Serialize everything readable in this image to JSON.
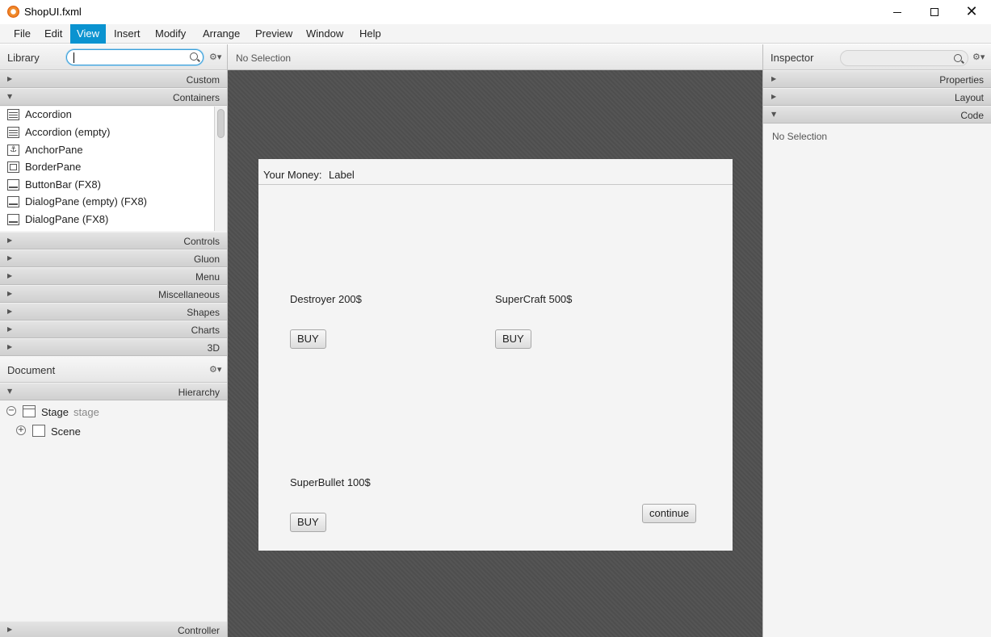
{
  "window": {
    "title": "ShopUI.fxml",
    "minimize_glyph": "",
    "maximize_glyph": "",
    "close_glyph": "✕"
  },
  "menu": [
    "File",
    "Edit",
    "View",
    "Insert",
    "Modify",
    "Arrange",
    "Preview",
    "Window",
    "Help"
  ],
  "menu_active": "View",
  "library": {
    "title": "Library",
    "search_value": "",
    "sections_top": [
      {
        "label": "Custom",
        "expanded": false
      },
      {
        "label": "Containers",
        "expanded": true
      }
    ],
    "items": [
      {
        "label": "Accordion",
        "icon": "accordion-icon"
      },
      {
        "label": "Accordion  (empty)",
        "icon": "accordion-icon"
      },
      {
        "label": "AnchorPane",
        "icon": "anchorpane-icon"
      },
      {
        "label": "BorderPane",
        "icon": "borderpane-icon"
      },
      {
        "label": "ButtonBar  (FX8)",
        "icon": "buttonbar-icon"
      },
      {
        "label": "DialogPane (empty)  (FX8)",
        "icon": "dialogpane-icon"
      },
      {
        "label": "DialogPane  (FX8)",
        "icon": "dialogpane-icon"
      }
    ],
    "sections_bottom": [
      "Controls",
      "Gluon",
      "Menu",
      "Miscellaneous",
      "Shapes",
      "Charts",
      "3D"
    ]
  },
  "document": {
    "title": "Document",
    "section": "Hierarchy",
    "tree": [
      {
        "label": "Stage",
        "sub": "stage",
        "expander": "−"
      },
      {
        "label": "Scene",
        "sub": "",
        "expander": "+"
      }
    ],
    "controller_label": "Controller"
  },
  "canvas": {
    "header": "No Selection",
    "money_label": "Your Money:",
    "money_value": "Label",
    "items": [
      {
        "label": "Destroyer  200$",
        "button": "BUY"
      },
      {
        "label": "SuperCraft  500$",
        "button": "BUY"
      },
      {
        "label": "SuperBullet  100$",
        "button": "BUY"
      }
    ],
    "continue_label": "continue"
  },
  "inspector": {
    "title": "Inspector",
    "search_value": "",
    "sections": [
      {
        "label": "Properties",
        "expanded": false
      },
      {
        "label": "Layout",
        "expanded": false
      },
      {
        "label": "Code",
        "expanded": true
      }
    ],
    "empty_text": "No Selection"
  },
  "colors": {
    "menu_active_bg": "#0a93d0",
    "canvas_bg": "#4e4e4e",
    "scene_bg": "#f4f4f4",
    "app_icon": "#f08a2a"
  }
}
